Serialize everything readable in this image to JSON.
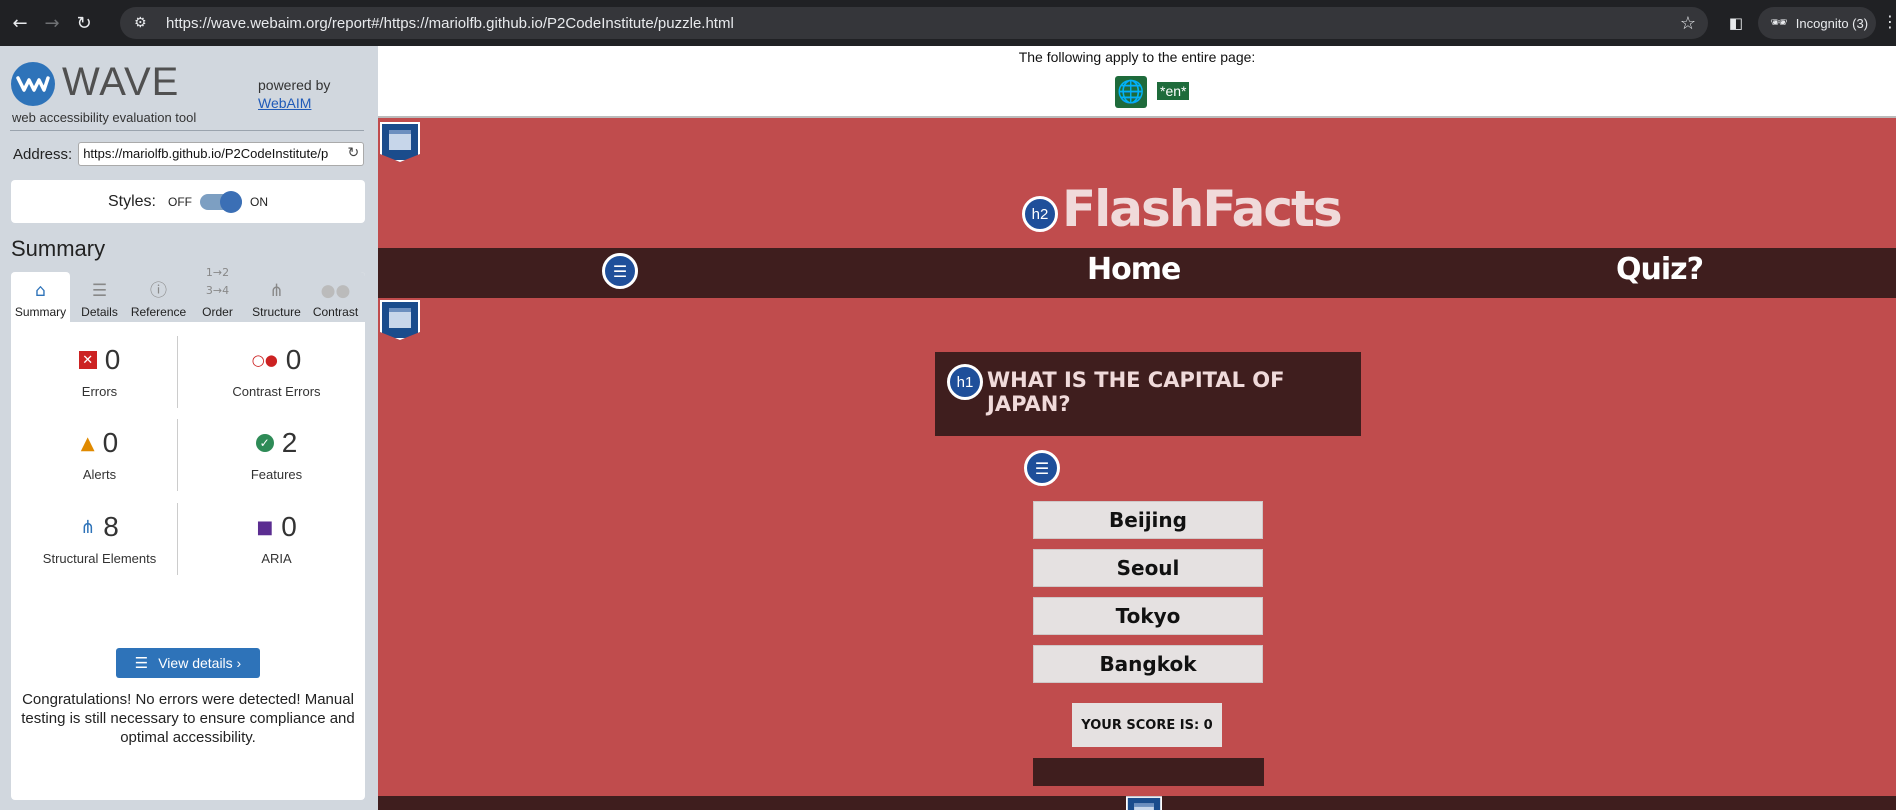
{
  "browser": {
    "url": "https://wave.webaim.org/report#/https://mariolfb.github.io/P2CodeInstitute/puzzle.html",
    "incognito_label": "Incognito (3)"
  },
  "wave": {
    "logo_text": "WAVE",
    "tagline": "web accessibility evaluation tool",
    "powered_by": "powered by",
    "powered_link": "WebAIM",
    "address_label": "Address:",
    "address_value": "https://mariolfb.github.io/P2CodeInstitute/p",
    "styles_label": "Styles:",
    "styles_off": "OFF",
    "styles_on": "ON",
    "summary_heading": "Summary",
    "tabs": [
      {
        "label": "Summary",
        "icon": "home-icon"
      },
      {
        "label": "Details",
        "icon": "list-icon"
      },
      {
        "label": "Reference",
        "icon": "info-icon"
      },
      {
        "label": "Order",
        "icon": "order-icon"
      },
      {
        "label": "Structure",
        "icon": "structure-icon"
      },
      {
        "label": "Contrast",
        "icon": "contrast-icon"
      }
    ],
    "stats": {
      "errors": {
        "value": "0",
        "label": "Errors"
      },
      "contrast_errors": {
        "value": "0",
        "label": "Contrast Errors"
      },
      "alerts": {
        "value": "0",
        "label": "Alerts"
      },
      "features": {
        "value": "2",
        "label": "Features"
      },
      "structural": {
        "value": "8",
        "label": "Structural Elements"
      },
      "aria": {
        "value": "0",
        "label": "ARIA"
      }
    },
    "view_details": "View details ›",
    "congrats": "Congratulations! No errors were detected! Manual testing is still necessary to ensure compliance and optimal accessibility."
  },
  "page": {
    "notice": "The following apply to the entire page:",
    "lang_tag": "*en*",
    "site_title": "FlashFacts",
    "h2_badge": "h2",
    "h1_badge": "h1",
    "nav": {
      "home": "Home",
      "quiz": "Quiz?"
    },
    "question": "WHAT IS THE CAPITAL OF JAPAN?",
    "answers": [
      "Beijing",
      "Seoul",
      "Tokyo",
      "Bangkok"
    ],
    "score": "YOUR SCORE IS: 0"
  },
  "colors": {
    "page_bg": "#c04c4d",
    "dark": "#3f1e1e",
    "wave_blue": "#2e73b9"
  }
}
